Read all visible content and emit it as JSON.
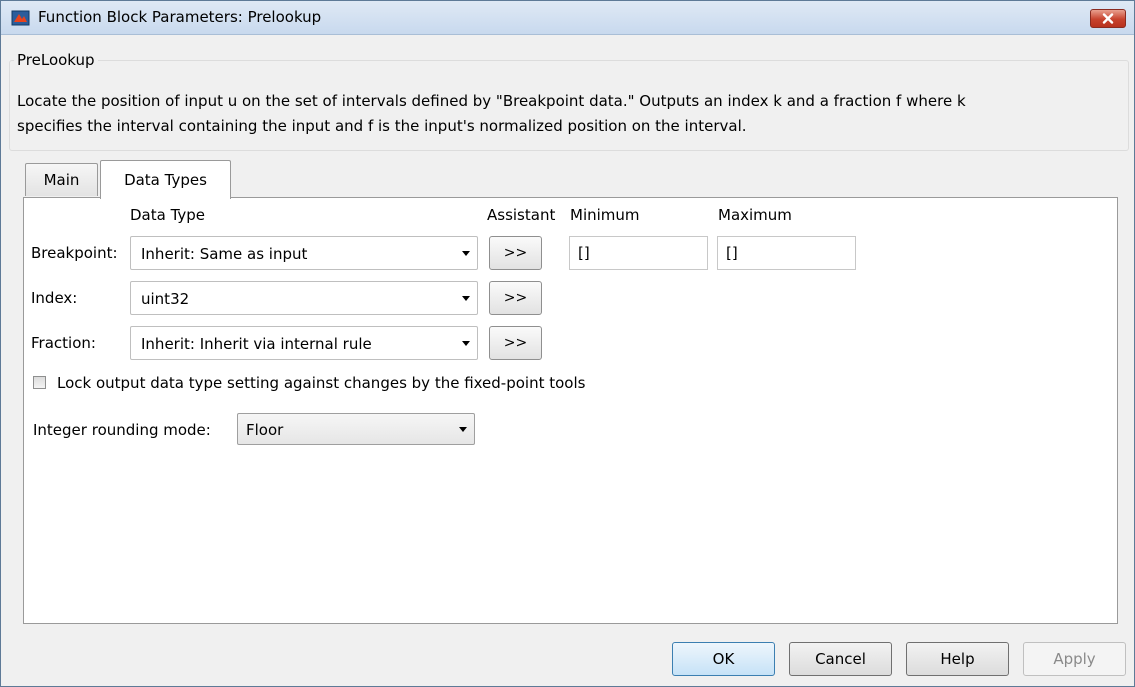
{
  "window": {
    "title": "Function Block Parameters: Prelookup",
    "icon": "simulink-block-icon",
    "close_icon": "close-icon"
  },
  "group": {
    "legend": "PreLookup",
    "description_line1": "Locate the position of input u on the set of intervals defined by \"Breakpoint data.\" Outputs an index k and a fraction f where k",
    "description_line2": "specifies the interval containing the input and f is the input's normalized position on the interval."
  },
  "tabs": [
    {
      "label": "Main",
      "active": false
    },
    {
      "label": "Data Types",
      "active": true
    }
  ],
  "data_types": {
    "headers": {
      "data_type": "Data Type",
      "assistant": "Assistant",
      "minimum": "Minimum",
      "maximum": "Maximum"
    },
    "rows": [
      {
        "label": "Breakpoint:",
        "value": "Inherit: Same as input",
        "assistant": ">>",
        "minimum": "[]",
        "maximum": "[]"
      },
      {
        "label": "Index:",
        "value": "uint32",
        "assistant": ">>"
      },
      {
        "label": "Fraction:",
        "value": "Inherit: Inherit via internal rule",
        "assistant": ">>"
      }
    ],
    "lock_checkbox": {
      "label": "Lock output data type setting against changes by the fixed-point tools",
      "checked": false
    },
    "rounding": {
      "label": "Integer rounding mode:",
      "value": "Floor"
    }
  },
  "buttons": {
    "ok": "OK",
    "cancel": "Cancel",
    "help": "Help",
    "apply": "Apply"
  },
  "colors": {
    "close_button": "#c7422d",
    "default_button_border": "#3c7fb1"
  }
}
